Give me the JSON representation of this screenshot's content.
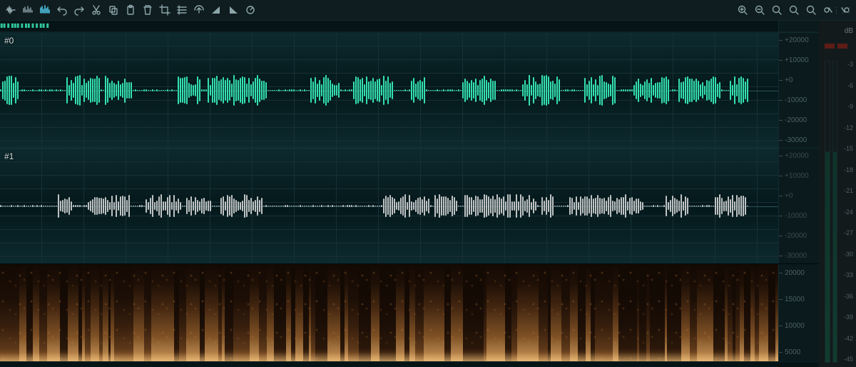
{
  "toolbar": {
    "left": [
      {
        "name": "view-waveform-icon"
      },
      {
        "name": "view-bars-icon"
      },
      {
        "name": "view-spectral-icon",
        "active": true
      },
      {
        "name": "undo-icon"
      },
      {
        "name": "redo-icon"
      },
      {
        "name": "cut-icon"
      },
      {
        "name": "copy-icon"
      },
      {
        "name": "paste-icon"
      },
      {
        "name": "delete-icon"
      },
      {
        "name": "crop-icon"
      },
      {
        "name": "fade-in-icon"
      },
      {
        "name": "insert-silence-icon"
      },
      {
        "name": "ramp-up-icon"
      },
      {
        "name": "ramp-down-icon"
      },
      {
        "name": "analyze-icon"
      }
    ],
    "right": [
      {
        "name": "zoom-in-icon"
      },
      {
        "name": "zoom-out-icon"
      },
      {
        "name": "zoom-selection-icon"
      },
      {
        "name": "zoom-fit-icon"
      },
      {
        "name": "zoom-1to1-icon"
      },
      {
        "name": "toggle-left-icon"
      },
      {
        "name": "toggle-right-icon"
      }
    ]
  },
  "channels": [
    {
      "label": "#0"
    },
    {
      "label": "#1"
    }
  ],
  "amp_scale": [
    "+20000",
    "+10000",
    "+0",
    "-10000",
    "-20000",
    "-30000"
  ],
  "spec_scale": [
    "20000",
    "15000",
    "10000",
    "5000"
  ],
  "spec_bottom_tick": "20000",
  "meter": {
    "unit": "dB",
    "ticks": [
      "-3",
      "-6",
      "-9",
      "-12",
      "-15",
      "-18",
      "-21",
      "-24",
      "-27",
      "-30",
      "-33",
      "-36",
      "-39",
      "-42",
      "-45"
    ]
  }
}
